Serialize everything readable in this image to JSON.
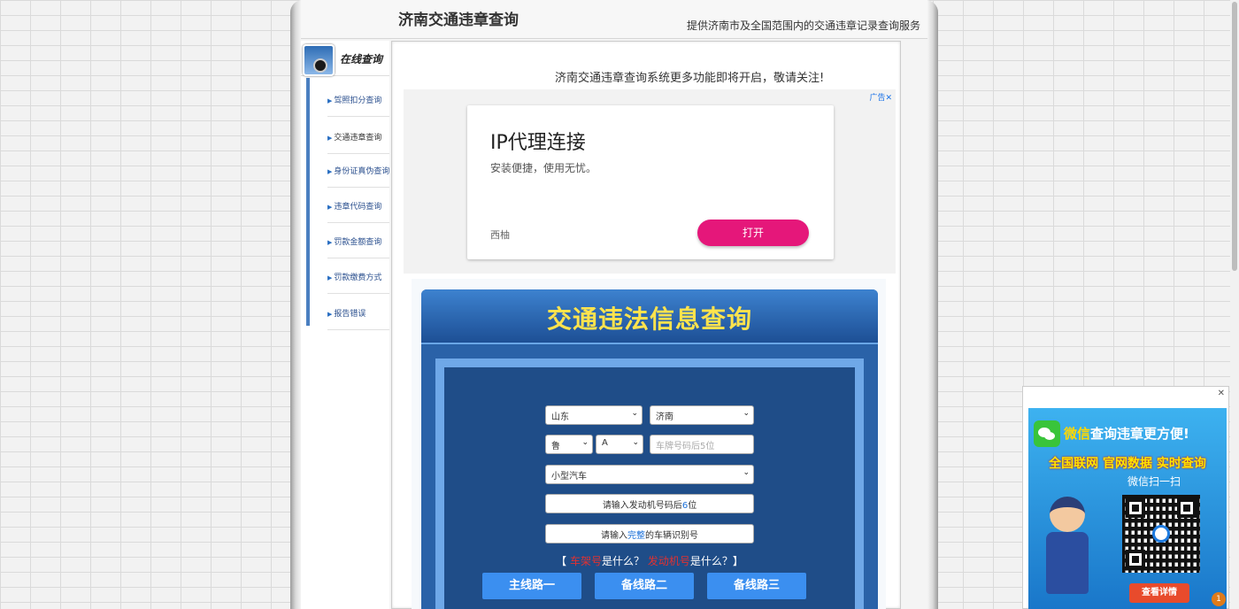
{
  "header": {
    "site_title": "济南交通违章查询",
    "slogan": "提供济南市及全国范围内的交通违章记录查询服务"
  },
  "leftnav": {
    "badge_text": "在线查询",
    "items": [
      {
        "label": "驾照扣分查询"
      },
      {
        "label": "交通违章查询"
      },
      {
        "label": "身份证真伪查询"
      },
      {
        "label": "违章代码查询"
      },
      {
        "label": "罚款金额查询"
      },
      {
        "label": "罚款缴费方式"
      },
      {
        "label": "报告错误"
      }
    ]
  },
  "main": {
    "notice": "济南交通违章查询系统更多功能即将开启，敬请关注!",
    "ad": {
      "label": "广告✕",
      "title": "IP代理连接",
      "desc": "安装便捷，使用无忧。",
      "brand": "西柚",
      "button": "打开"
    }
  },
  "query": {
    "title": "交通违法信息查询",
    "province": "山东",
    "city": "济南",
    "plate_prefix": "鲁",
    "plate_letter": "A",
    "plate_placeholder": "车牌号码后5位",
    "vehicle_type": "小型汽车",
    "engine_pre": "请输入发动机号码后",
    "engine_num": "6",
    "engine_post": "位",
    "vin_pre": "请输入",
    "vin_hl": "完整",
    "vin_post": "的车辆识别号",
    "help_open": "【",
    "help_term1": "车架号",
    "help_q1": "是什么？",
    "help_term2": "发动机号",
    "help_q2": "是什么？】",
    "routes": [
      "主线路一",
      "备线路二",
      "备线路三"
    ]
  },
  "float_ad": {
    "close": "✕",
    "line1_accent": "微信",
    "line1_rest": "查询违章更方便!",
    "line2": "全国联网 官网数据 实时查询",
    "line3": "微信扫一扫",
    "button": "查看详情",
    "badge": "1"
  }
}
